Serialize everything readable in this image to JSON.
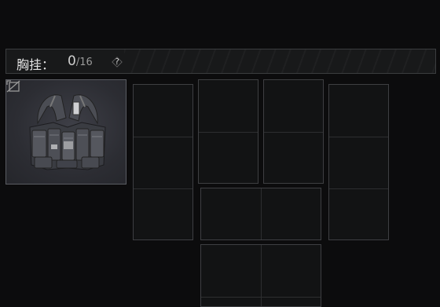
{
  "header": {
    "title": "胸挂：",
    "count_current": "0",
    "count_max": "/16",
    "help_label": "?"
  },
  "item": {
    "name_icon": "chest-rig-image",
    "status_icon": "no-image-icon"
  },
  "colors": {
    "background": "#0c0c0d",
    "slot_border": "#3e3f42",
    "item_border": "#5a5c62"
  }
}
